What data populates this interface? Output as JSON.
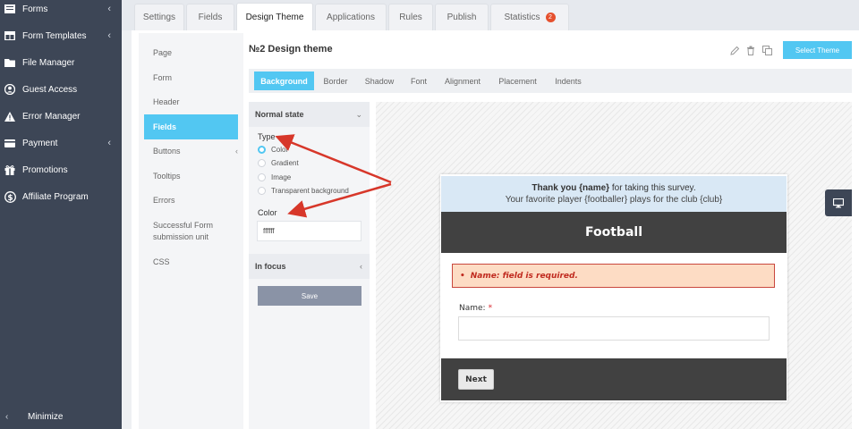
{
  "sidebar": {
    "items": [
      {
        "label": "Forms",
        "icon": "forms-icon",
        "has_chevron": true
      },
      {
        "label": "Form Templates",
        "icon": "template-icon",
        "has_chevron": true
      },
      {
        "label": "File Manager",
        "icon": "folder-icon",
        "has_chevron": false
      },
      {
        "label": "Guest Access",
        "icon": "user-icon",
        "has_chevron": false
      },
      {
        "label": "Error Manager",
        "icon": "warning-icon",
        "has_chevron": false
      },
      {
        "label": "Payment",
        "icon": "card-icon",
        "has_chevron": true
      },
      {
        "label": "Promotions",
        "icon": "gift-icon",
        "has_chevron": false
      },
      {
        "label": "Affiliate Program",
        "icon": "dollar-icon",
        "has_chevron": false
      }
    ],
    "minimize_label": "Minimize"
  },
  "tabs": [
    {
      "label": "Settings"
    },
    {
      "label": "Fields"
    },
    {
      "label": "Design Theme",
      "active": true
    },
    {
      "label": "Applications"
    },
    {
      "label": "Rules"
    },
    {
      "label": "Publish"
    },
    {
      "label": "Statistics",
      "badge": "2"
    }
  ],
  "left_nav": {
    "items": [
      {
        "label": "Page"
      },
      {
        "label": "Form"
      },
      {
        "label": "Header"
      },
      {
        "label": "Fields",
        "active": true
      },
      {
        "label": "Buttons"
      },
      {
        "label": "Tooltips"
      },
      {
        "label": "Errors"
      },
      {
        "label": "Successful Form submission unit"
      },
      {
        "label": "CSS"
      }
    ]
  },
  "header": {
    "title": "№2 Design theme",
    "select_theme_label": "Select Theme"
  },
  "subtabs": [
    {
      "label": "Background",
      "active": true
    },
    {
      "label": "Border"
    },
    {
      "label": "Shadow"
    },
    {
      "label": "Font"
    },
    {
      "label": "Alignment"
    },
    {
      "label": "Placement"
    },
    {
      "label": "Indents"
    }
  ],
  "settings": {
    "normal_state_label": "Normal state",
    "type_label": "Type",
    "type_options": [
      {
        "label": "Color",
        "checked": true
      },
      {
        "label": "Gradient"
      },
      {
        "label": "Image"
      },
      {
        "label": "Transparent background"
      }
    ],
    "color_label": "Color",
    "color_value": "ffffff",
    "in_focus_label": "In focus",
    "save_label": "Save"
  },
  "preview": {
    "thanks_pre": "Thank you {name}",
    "thanks_post": " for taking this survey.",
    "thanks_line2": "Your favorite player {footballer} plays for the club {club}",
    "form_title": "Football",
    "error_text": "Name: field is required.",
    "name_label": "Name:",
    "required_mark": "*",
    "next_label": "Next"
  },
  "colors": {
    "accent": "#52c7f2",
    "sidebar_bg": "#3d4656",
    "annotation_arrow": "#d7372a"
  }
}
